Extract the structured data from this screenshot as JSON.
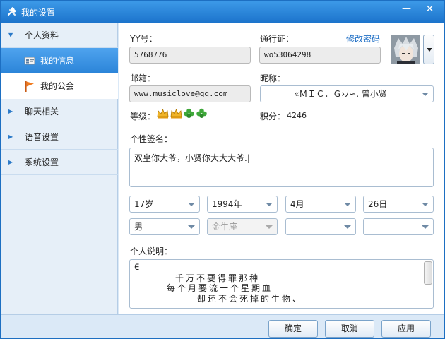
{
  "window": {
    "title": "我的设置",
    "minimize": "—",
    "close": "✕"
  },
  "sidebar": {
    "groups": [
      {
        "label": "个人资料",
        "expanded": true
      },
      {
        "label": "聊天相关",
        "expanded": false
      },
      {
        "label": "语音设置",
        "expanded": false
      },
      {
        "label": "系统设置",
        "expanded": false
      }
    ],
    "sub_items": [
      {
        "label": "我的信息",
        "active": true,
        "icon": "id-card-icon"
      },
      {
        "label": "我的公会",
        "active": false,
        "icon": "flag-icon"
      }
    ]
  },
  "profile": {
    "yy_label": "YY号：",
    "yy_value": "5768776",
    "passport_label": "通行证：",
    "passport_value": "wo53064298",
    "change_password": "修改密码",
    "email_label": "邮箱：",
    "email_value": "www.musiclove@qq.com",
    "nickname_label": "昵称：",
    "nickname_value": "«ＭＩＣ．Ｇ›ﾉ∽. 曾小贤",
    "level_label": "等级：",
    "level_icons": [
      "crown-icon",
      "crown-icon",
      "clover-icon",
      "clover-icon"
    ],
    "points_label": "积分：",
    "points_value": "4246",
    "signature_label": "个性签名：",
    "signature_value": "双皇你大爷，小贤你大大大爷.|",
    "age": "17岁",
    "birth_year": "1994年",
    "birth_month": "4月",
    "birth_day": "26日",
    "gender": "男",
    "zodiac": "金牛座",
    "blank_select_1": "",
    "blank_select_2": "",
    "description_label": "个人说明：",
    "description_lines": [
      "∈",
      "千万不要得罪那种",
      "每个月要流一个星期血",
      "却还不会死掉的生物、"
    ]
  },
  "footer": {
    "ok": "确定",
    "cancel": "取消",
    "apply": "应用"
  },
  "colors": {
    "titlebar": "#1c74cc",
    "active_item": "#2b84d8",
    "link": "#1f6fc5",
    "crown": "#f0b429",
    "clover": "#3fa83a"
  }
}
